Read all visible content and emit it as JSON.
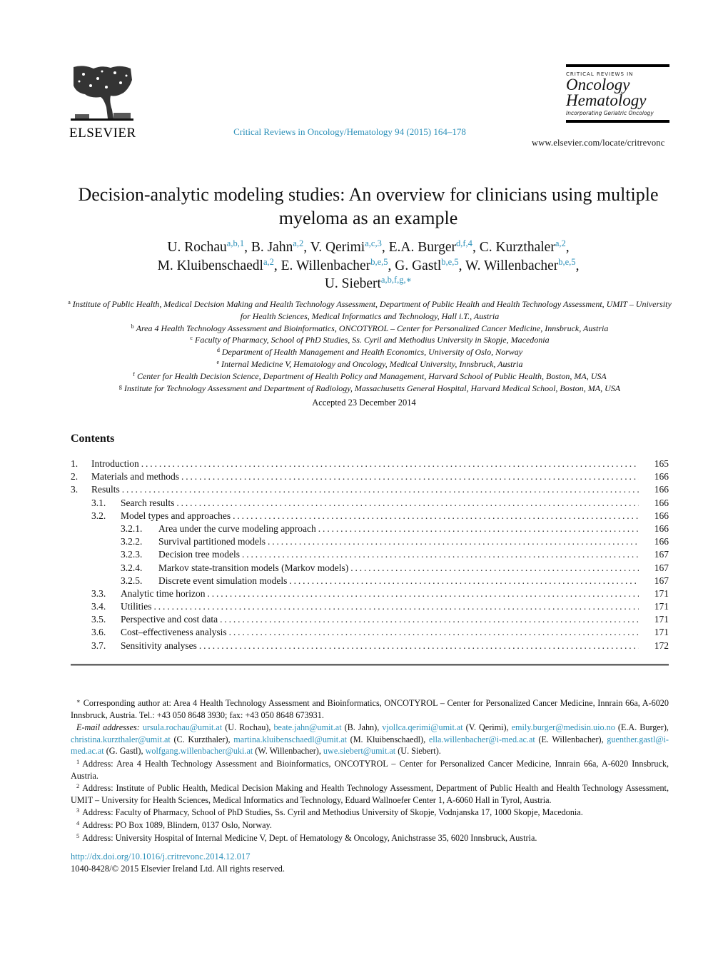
{
  "header": {
    "publisher_logo_text": "ELSEVIER",
    "journal_reference": "Critical Reviews in Oncology/Hematology 94 (2015) 164–178",
    "journal_logo": {
      "series": "CRITICAL REVIEWS IN",
      "name_line1": "Oncology",
      "name_line2": "Hematology",
      "subtitle": "Incorporating Geriatric Oncology"
    },
    "journal_url": "www.elsevier.com/locate/critrevonc"
  },
  "article": {
    "title": "Decision-analytic modeling studies: An overview for clinicians using multiple myeloma as an example",
    "authors": [
      {
        "name": "U. Rochau",
        "sup": "a,b,1",
        "sep": ", "
      },
      {
        "name": "B. Jahn",
        "sup": "a,2",
        "sep": ", "
      },
      {
        "name": "V. Qerimi",
        "sup": "a,c,3",
        "sep": ", "
      },
      {
        "name": "E.A. Burger",
        "sup": "d,f,4",
        "sep": ", "
      },
      {
        "name": "C. Kurzthaler",
        "sup": "a,2",
        "sep": ","
      },
      {
        "name": "M. Kluibenschaedl",
        "sup": "a,2",
        "sep": ", "
      },
      {
        "name": "E. Willenbacher",
        "sup": "b,e,5",
        "sep": ", "
      },
      {
        "name": "G. Gastl",
        "sup": "b,e,5",
        "sep": ", "
      },
      {
        "name": "W. Willenbacher",
        "sup": "b,e,5",
        "sep": ","
      },
      {
        "name": "U. Siebert",
        "sup": "a,b,f,g,∗",
        "sep": ""
      }
    ],
    "affiliations": [
      {
        "key": "a",
        "text": "Institute of Public Health, Medical Decision Making and Health Technology Assessment, Department of Public Health and Health Technology Assessment, UMIT – University for Health Sciences, Medical Informatics and Technology, Hall i.T., Austria"
      },
      {
        "key": "b",
        "text": "Area 4 Health Technology Assessment and Bioinformatics, ONCOTYROL – Center for Personalized Cancer Medicine, Innsbruck, Austria"
      },
      {
        "key": "c",
        "text": "Faculty of Pharmacy, School of PhD Studies, Ss. Cyril and Methodius University in Skopje, Macedonia"
      },
      {
        "key": "d",
        "text": "Department of Health Management and Health Economics, University of Oslo, Norway"
      },
      {
        "key": "e",
        "text": "Internal Medicine V, Hematology and Oncology, Medical University, Innsbruck, Austria"
      },
      {
        "key": "f",
        "text": "Center for Health Decision Science, Department of Health Policy and Management, Harvard School of Public Health, Boston, MA, USA"
      },
      {
        "key": "g",
        "text": "Institute for Technology Assessment and Department of Radiology, Massachusetts General Hospital, Harvard Medical School, Boston, MA, USA"
      }
    ],
    "accepted": "Accepted 23 December 2014"
  },
  "contents": {
    "heading": "Contents",
    "items": [
      {
        "num": "1.",
        "title": "Introduction",
        "page": "165",
        "level": 1
      },
      {
        "num": "2.",
        "title": "Materials and methods",
        "page": "166",
        "level": 1
      },
      {
        "num": "3.",
        "title": "Results",
        "page": "166",
        "level": 1
      },
      {
        "num": "3.1.",
        "title": "Search results",
        "page": "166",
        "level": 2
      },
      {
        "num": "3.2.",
        "title": "Model types and approaches",
        "page": "166",
        "level": 2
      },
      {
        "num": "3.2.1.",
        "title": "Area under the curve modeling approach",
        "page": "166",
        "level": 3
      },
      {
        "num": "3.2.2.",
        "title": "Survival partitioned models",
        "page": "166",
        "level": 3
      },
      {
        "num": "3.2.3.",
        "title": "Decision tree models",
        "page": "167",
        "level": 3
      },
      {
        "num": "3.2.4.",
        "title": "Markov state-transition models (Markov models)",
        "page": "167",
        "level": 3
      },
      {
        "num": "3.2.5.",
        "title": "Discrete event simulation models",
        "page": "167",
        "level": 3
      },
      {
        "num": "3.3.",
        "title": "Analytic time horizon",
        "page": "171",
        "level": 2
      },
      {
        "num": "3.4.",
        "title": "Utilities",
        "page": "171",
        "level": 2
      },
      {
        "num": "3.5.",
        "title": "Perspective and cost data",
        "page": "171",
        "level": 2
      },
      {
        "num": "3.6.",
        "title": "Cost–effectiveness analysis",
        "page": "171",
        "level": 2
      },
      {
        "num": "3.7.",
        "title": "Sensitivity analyses",
        "page": "172",
        "level": 2
      }
    ]
  },
  "footnotes": {
    "corresponding_mark": "∗",
    "corresponding": "Corresponding author at: Area 4 Health Technology Assessment and Bioinformatics, ONCOTYROL – Center for Personalized Cancer Medicine, Innrain 66a, A-6020 Innsbruck, Austria. Tel.: +43 050 8648 3930; fax: +43 050 8648 673931.",
    "email_label": "E-mail addresses:",
    "emails": [
      {
        "email": "ursula.rochau@umit.at",
        "name": "(U. Rochau)"
      },
      {
        "email": "beate.jahn@umit.at",
        "name": "(B. Jahn)"
      },
      {
        "email": "vjollca.qerimi@umit.at",
        "name": "(V. Qerimi)"
      },
      {
        "email": "emily.burger@medisin.uio.no",
        "name": "(E.A. Burger)"
      },
      {
        "email": "christina.kurzthaler@umit.at",
        "name": "(C. Kurzthaler)"
      },
      {
        "email": "martina.kluibenschaedl@umit.at",
        "name": "(M. Kluibenschaedl)"
      },
      {
        "email": "ella.willenbacher@i-med.ac.at",
        "name": "(E. Willenbacher)"
      },
      {
        "email": "guenther.gastl@i-med.ac.at",
        "name": "(G. Gastl)"
      },
      {
        "email": "wolfgang.willenbacher@uki.at",
        "name": "(W. Willenbacher)"
      },
      {
        "email": "uwe.siebert@umit.at",
        "name": "(U. Siebert)."
      }
    ],
    "addresses": [
      {
        "key": "1",
        "text": "Address: Area 4 Health Technology Assessment and Bioinformatics, ONCOTYROL – Center for Personalized Cancer Medicine, Innrain 66a, A-6020 Innsbruck, Austria."
      },
      {
        "key": "2",
        "text": "Address: Institute of Public Health, Medical Decision Making and Health Technology Assessment, Department of Public Health and Health Technology Assessment, UMIT – University for Health Sciences, Medical Informatics and Technology, Eduard Wallnoefer Center 1, A-6060 Hall in Tyrol, Austria."
      },
      {
        "key": "3",
        "text": "Address: Faculty of Pharmacy, School of PhD Studies, Ss. Cyril and Methodius University of Skopje, Vodnjanska 17, 1000 Skopje, Macedonia."
      },
      {
        "key": "4",
        "text": "Address: PO Box 1089, Blindern, 0137 Oslo, Norway."
      },
      {
        "key": "5",
        "text": "Address: University Hospital of Internal Medicine V, Dept. of Hematology & Oncology, Anichstrasse 35, 6020 Innsbruck, Austria."
      }
    ]
  },
  "doi": "http://dx.doi.org/10.1016/j.critrevonc.2014.12.017",
  "copyright": "1040-8428/© 2015 Elsevier Ireland Ltd. All rights reserved.",
  "colors": {
    "link": "#2a8fb8",
    "text": "#111111"
  }
}
